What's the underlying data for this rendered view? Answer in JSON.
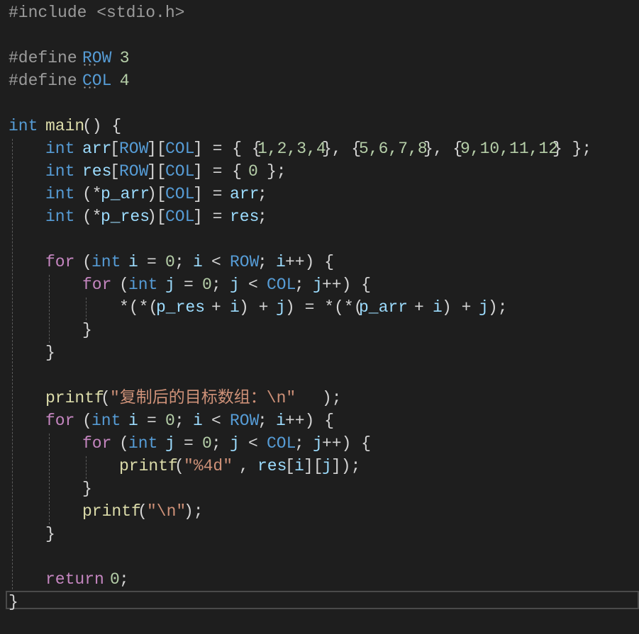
{
  "editor": {
    "theme": {
      "background": "#1e1e1e",
      "keyword": "#569cd6",
      "control": "#c586c0",
      "function": "#dcdcaa",
      "variable": "#9cdcfe",
      "string": "#ce9178",
      "number": "#b5cea8",
      "macro": "#569cd6",
      "plain": "#d4d4d4",
      "preprocessor": "#9b9b9b"
    },
    "lines": [
      {
        "tokens": [
          {
            "text": "#include <stdio.h>",
            "c": "pre",
            "col": 0
          }
        ]
      },
      {
        "tokens": []
      },
      {
        "tokens": [
          {
            "text": "#define ",
            "c": "pre",
            "col": 0
          },
          {
            "text": "ROW",
            "c": "macro",
            "col": 8
          },
          {
            "text": " 3",
            "c": "num",
            "col": 11
          }
        ]
      },
      {
        "tokens": [
          {
            "text": "#define ",
            "c": "pre",
            "col": 0
          },
          {
            "text": "COL",
            "c": "macro",
            "col": 8
          },
          {
            "text": " 4",
            "c": "num",
            "col": 11
          }
        ]
      },
      {
        "tokens": []
      },
      {
        "tokens": [
          {
            "text": "int",
            "c": "kw",
            "col": 0
          },
          {
            "text": "main",
            "c": "fn",
            "col": 4
          },
          {
            "text": "() {",
            "c": "plain",
            "col": 8
          }
        ]
      },
      {
        "tokens": [
          {
            "text": "int",
            "c": "kw",
            "col": 4
          },
          {
            "text": "arr",
            "c": "var",
            "col": 8
          },
          {
            "text": "[",
            "c": "plain",
            "col": 11
          },
          {
            "text": "ROW",
            "c": "macro",
            "col": 12
          },
          {
            "text": "][",
            "c": "plain",
            "col": 15
          },
          {
            "text": "COL",
            "c": "macro",
            "col": 17
          },
          {
            "text": "] = { {",
            "c": "plain",
            "col": 20
          },
          {
            "text": "1,2,3,4",
            "c": "num",
            "col": 27
          },
          {
            "text": "}, {",
            "c": "plain",
            "col": 34
          },
          {
            "text": "5,6,7,8",
            "c": "num",
            "col": 38
          },
          {
            "text": "}, {",
            "c": "plain",
            "col": 45
          },
          {
            "text": "9,10,11,12",
            "c": "num",
            "col": 49
          },
          {
            "text": "} };",
            "c": "plain",
            "col": 59
          }
        ]
      },
      {
        "tokens": [
          {
            "text": "int",
            "c": "kw",
            "col": 4
          },
          {
            "text": "res",
            "c": "var",
            "col": 8
          },
          {
            "text": "[",
            "c": "plain",
            "col": 11
          },
          {
            "text": "ROW",
            "c": "macro",
            "col": 12
          },
          {
            "text": "][",
            "c": "plain",
            "col": 15
          },
          {
            "text": "COL",
            "c": "macro",
            "col": 17
          },
          {
            "text": "] = {",
            "c": "plain",
            "col": 20
          },
          {
            "text": "0",
            "c": "num",
            "col": 26
          },
          {
            "text": "};",
            "c": "plain",
            "col": 28
          }
        ]
      },
      {
        "tokens": [
          {
            "text": "int",
            "c": "kw",
            "col": 4
          },
          {
            "text": "(*",
            "c": "plain",
            "col": 8
          },
          {
            "text": "p_arr",
            "c": "var",
            "col": 10
          },
          {
            "text": ")[",
            "c": "plain",
            "col": 15
          },
          {
            "text": "COL",
            "c": "macro",
            "col": 17
          },
          {
            "text": "] =",
            "c": "plain",
            "col": 20
          },
          {
            "text": "arr",
            "c": "var",
            "col": 24
          },
          {
            "text": ";",
            "c": "plain",
            "col": 27
          }
        ]
      },
      {
        "tokens": [
          {
            "text": "int",
            "c": "kw",
            "col": 4
          },
          {
            "text": "(*",
            "c": "plain",
            "col": 8
          },
          {
            "text": "p_res",
            "c": "var",
            "col": 10
          },
          {
            "text": ")[",
            "c": "plain",
            "col": 15
          },
          {
            "text": "COL",
            "c": "macro",
            "col": 17
          },
          {
            "text": "] =",
            "c": "plain",
            "col": 20
          },
          {
            "text": "res",
            "c": "var",
            "col": 24
          },
          {
            "text": ";",
            "c": "plain",
            "col": 27
          }
        ]
      },
      {
        "tokens": []
      },
      {
        "tokens": [
          {
            "text": "for",
            "c": "ctl",
            "col": 4
          },
          {
            "text": "(",
            "c": "plain",
            "col": 8
          },
          {
            "text": "int",
            "c": "kw",
            "col": 9
          },
          {
            "text": "i",
            "c": "var",
            "col": 13
          },
          {
            "text": "=",
            "c": "plain",
            "col": 15
          },
          {
            "text": "0",
            "c": "num",
            "col": 17
          },
          {
            "text": ";",
            "c": "plain",
            "col": 18
          },
          {
            "text": "i",
            "c": "var",
            "col": 20
          },
          {
            "text": "<",
            "c": "plain",
            "col": 22
          },
          {
            "text": "ROW",
            "c": "macro",
            "col": 24
          },
          {
            "text": ";",
            "c": "plain",
            "col": 27
          },
          {
            "text": "i",
            "c": "var",
            "col": 29
          },
          {
            "text": "++) {",
            "c": "plain",
            "col": 30
          }
        ]
      },
      {
        "tokens": [
          {
            "text": "for",
            "c": "ctl",
            "col": 8
          },
          {
            "text": "(",
            "c": "plain",
            "col": 12
          },
          {
            "text": "int",
            "c": "kw",
            "col": 13
          },
          {
            "text": "j",
            "c": "var",
            "col": 17
          },
          {
            "text": "=",
            "c": "plain",
            "col": 19
          },
          {
            "text": "0",
            "c": "num",
            "col": 21
          },
          {
            "text": ";",
            "c": "plain",
            "col": 22
          },
          {
            "text": "j",
            "c": "var",
            "col": 24
          },
          {
            "text": "<",
            "c": "plain",
            "col": 26
          },
          {
            "text": "COL",
            "c": "macro",
            "col": 28
          },
          {
            "text": ";",
            "c": "plain",
            "col": 31
          },
          {
            "text": "j",
            "c": "var",
            "col": 33
          },
          {
            "text": "++) {",
            "c": "plain",
            "col": 34
          }
        ]
      },
      {
        "tokens": [
          {
            "text": "*(*(",
            "c": "plain",
            "col": 12
          },
          {
            "text": "p_res",
            "c": "var",
            "col": 16
          },
          {
            "text": "+",
            "c": "plain",
            "col": 22
          },
          {
            "text": "i",
            "c": "var",
            "col": 24
          },
          {
            "text": ") +",
            "c": "plain",
            "col": 25
          },
          {
            "text": "j",
            "c": "var",
            "col": 29
          },
          {
            "text": ") = *(*(",
            "c": "plain",
            "col": 30
          },
          {
            "text": "p_arr",
            "c": "var",
            "col": 38
          },
          {
            "text": "+",
            "c": "plain",
            "col": 44
          },
          {
            "text": "i",
            "c": "var",
            "col": 46
          },
          {
            "text": ") +",
            "c": "plain",
            "col": 47
          },
          {
            "text": "j",
            "c": "var",
            "col": 51
          },
          {
            "text": ");",
            "c": "plain",
            "col": 52
          }
        ]
      },
      {
        "tokens": [
          {
            "text": "}",
            "c": "plain",
            "col": 8
          }
        ]
      },
      {
        "tokens": [
          {
            "text": "}",
            "c": "plain",
            "col": 4
          }
        ]
      },
      {
        "tokens": []
      },
      {
        "tokens": [
          {
            "text": "printf",
            "c": "fn",
            "col": 4
          },
          {
            "text": "(",
            "c": "plain",
            "col": 10
          },
          {
            "text": "\"复制后的目标数组：\\n\"",
            "c": "str",
            "col": 11
          },
          {
            "text": ");",
            "c": "plain",
            "col": 34
          }
        ]
      },
      {
        "tokens": [
          {
            "text": "for",
            "c": "ctl",
            "col": 4
          },
          {
            "text": "(",
            "c": "plain",
            "col": 8
          },
          {
            "text": "int",
            "c": "kw",
            "col": 9
          },
          {
            "text": "i",
            "c": "var",
            "col": 13
          },
          {
            "text": "=",
            "c": "plain",
            "col": 15
          },
          {
            "text": "0",
            "c": "num",
            "col": 17
          },
          {
            "text": ";",
            "c": "plain",
            "col": 18
          },
          {
            "text": "i",
            "c": "var",
            "col": 20
          },
          {
            "text": "<",
            "c": "plain",
            "col": 22
          },
          {
            "text": "ROW",
            "c": "macro",
            "col": 24
          },
          {
            "text": ";",
            "c": "plain",
            "col": 27
          },
          {
            "text": "i",
            "c": "var",
            "col": 29
          },
          {
            "text": "++) {",
            "c": "plain",
            "col": 30
          }
        ]
      },
      {
        "tokens": [
          {
            "text": "for",
            "c": "ctl",
            "col": 8
          },
          {
            "text": "(",
            "c": "plain",
            "col": 12
          },
          {
            "text": "int",
            "c": "kw",
            "col": 13
          },
          {
            "text": "j",
            "c": "var",
            "col": 17
          },
          {
            "text": "=",
            "c": "plain",
            "col": 19
          },
          {
            "text": "0",
            "c": "num",
            "col": 21
          },
          {
            "text": ";",
            "c": "plain",
            "col": 22
          },
          {
            "text": "j",
            "c": "var",
            "col": 24
          },
          {
            "text": "<",
            "c": "plain",
            "col": 26
          },
          {
            "text": "COL",
            "c": "macro",
            "col": 28
          },
          {
            "text": ";",
            "c": "plain",
            "col": 31
          },
          {
            "text": "j",
            "c": "var",
            "col": 33
          },
          {
            "text": "++) {",
            "c": "plain",
            "col": 34
          }
        ]
      },
      {
        "tokens": [
          {
            "text": "printf",
            "c": "fn",
            "col": 12
          },
          {
            "text": "(",
            "c": "plain",
            "col": 18
          },
          {
            "text": "\"%4d\"",
            "c": "str",
            "col": 19
          },
          {
            "text": ",",
            "c": "plain",
            "col": 25
          },
          {
            "text": "res",
            "c": "var",
            "col": 27
          },
          {
            "text": "[",
            "c": "plain",
            "col": 30
          },
          {
            "text": "i",
            "c": "var",
            "col": 31
          },
          {
            "text": "][",
            "c": "plain",
            "col": 32
          },
          {
            "text": "j",
            "c": "var",
            "col": 34
          },
          {
            "text": "]);",
            "c": "plain",
            "col": 35
          }
        ]
      },
      {
        "tokens": [
          {
            "text": "}",
            "c": "plain",
            "col": 8
          }
        ]
      },
      {
        "tokens": [
          {
            "text": "printf",
            "c": "fn",
            "col": 8
          },
          {
            "text": "(",
            "c": "plain",
            "col": 14
          },
          {
            "text": "\"\\n\"",
            "c": "str",
            "col": 15
          },
          {
            "text": ");",
            "c": "plain",
            "col": 19
          }
        ]
      },
      {
        "tokens": [
          {
            "text": "}",
            "c": "plain",
            "col": 4
          }
        ]
      },
      {
        "tokens": []
      },
      {
        "tokens": [
          {
            "text": "return",
            "c": "ctl",
            "col": 4
          },
          {
            "text": "0",
            "c": "num",
            "col": 11
          },
          {
            "text": ";",
            "c": "plain",
            "col": 12
          }
        ]
      },
      {
        "tokens": [
          {
            "text": "}",
            "c": "plain",
            "col": 0
          }
        ]
      }
    ]
  }
}
